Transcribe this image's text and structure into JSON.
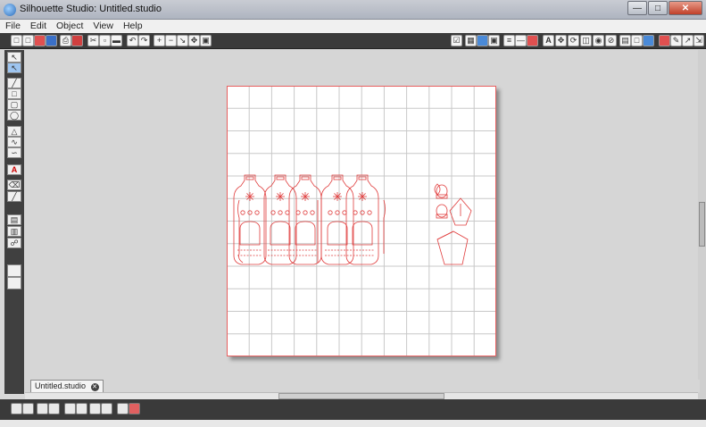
{
  "window": {
    "title": "Silhouette Studio: Untitled.studio"
  },
  "menu": [
    "File",
    "Edit",
    "Object",
    "View",
    "Help"
  ],
  "document_tab": {
    "label": "Untitled.studio"
  },
  "colors": {
    "toolbar": "#3a3a3a",
    "cut_line": "#e03c3c",
    "grid_line": "#c8c8c8",
    "mat_border": "#e86060"
  },
  "icons": {
    "toolbar_left": [
      "new-icon",
      "open-icon",
      "save-icon",
      "save-blue-icon",
      "print-icon",
      "print-cut-icon",
      "cut-icon",
      "copy-icon",
      "paste-icon",
      "undo-icon",
      "redo-icon",
      "zoom-in-icon",
      "zoom-out-icon",
      "zoom-select-icon",
      "pan-icon",
      "fit-page-icon"
    ],
    "toolbar_right": [
      "lock-icon",
      "grid-icon",
      "page-setup-icon",
      "registration-icon",
      "line-style-icon",
      "line-width-icon",
      "fill-icon",
      "text-style-icon",
      "transform-icon",
      "replicate-icon",
      "modify-icon",
      "offset-icon",
      "trace-icon",
      "library-icon",
      "store-icon",
      "design-icon",
      "cut-settings-icon",
      "send-icon",
      "pen-icon",
      "expand-icon"
    ]
  }
}
